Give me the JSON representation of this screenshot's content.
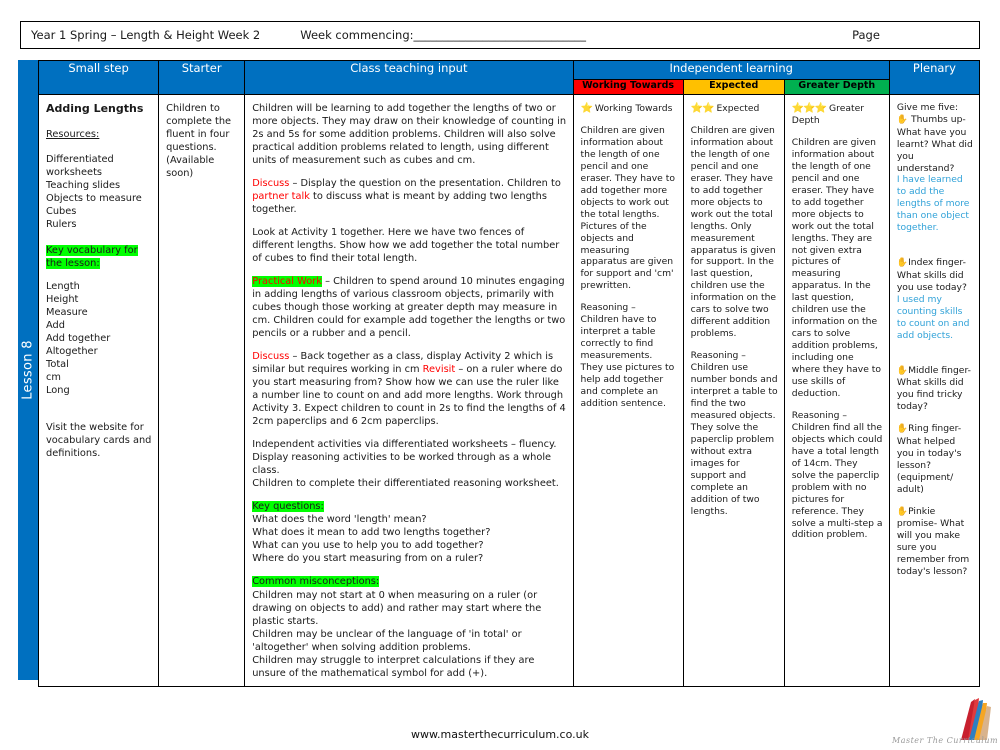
{
  "header": {
    "title": "Year 1 Spring – Length & Height Week 2",
    "week_commencing_label": "Week commencing:",
    "week_commencing_value": "______________________________",
    "page_label": "Page"
  },
  "lesson_tab": {
    "label": "Lesson 8"
  },
  "columns": {
    "small_step": "Small step",
    "starter": "Starter",
    "class_teaching_input": "Class teaching input",
    "independent_learning": "Independent learning",
    "plenary": "Plenary",
    "working_towards": "Working Towards",
    "expected": "Expected",
    "greater_depth": "Greater Depth"
  },
  "colors": {
    "header_blue": "#0070C0",
    "working_towards_red": "#FF0000",
    "expected_amber": "#FFC000",
    "greater_depth_green": "#00B050",
    "highlight_green": "#00FF00",
    "accent_red_text": "#FF0000",
    "plenary_blue_text": "#31A2D8",
    "star_gold": "#FFC000"
  },
  "small_step": {
    "title": "Adding Lengths",
    "resources_label": "Resources:",
    "resources": [
      "Differentiated worksheets",
      "Teaching slides",
      "Objects to measure",
      "Cubes",
      "Rulers"
    ],
    "key_vocabulary_label": "Key vocabulary for the lesson:",
    "vocabulary": [
      "Length",
      "Height",
      "Measure",
      "Add",
      "Add together",
      "Altogether",
      "Total",
      "cm",
      "Long"
    ],
    "website_note": "Visit the website for vocabulary cards and definitions."
  },
  "starter": {
    "text": "Children to complete the fluent in four questions. (Available soon)"
  },
  "teaching_input": {
    "intro": "Children will be learning to add together the lengths of two or more objects. They may draw on their knowledge of counting in 2s and 5s for some addition problems. Children will also solve practical addition problems related to length, using different units of measurement such as cubes and cm.",
    "discuss_label_1": "Discuss",
    "discuss_1_a": " – Display the question on the presentation. Children to ",
    "partner_talk_label": "partner talk",
    "discuss_1_b": " to discuss what is meant by adding two lengths together.",
    "activity_1": "Look at Activity 1 together. Here we have two fences of different lengths. Show how we add together the total number of cubes to find their total length.",
    "practical_label": "Practical Work",
    "practical_text": " – Children to spend around 10 minutes engaging in adding lengths of various classroom objects, primarily with cubes though those working at greater depth may measure in cm. Children could for example add together the lengths or two pencils or a rubber and a pencil.",
    "discuss_label_2": "Discuss",
    "discuss_2_a": " – Back together as a class, display Activity 2 which is similar but requires working in cm ",
    "revisit_label": "Revisit",
    "discuss_2_b": " – on a ruler where do you start measuring from? Show how we can use the ruler like a number line to count on and add more lengths. Work through Activity 3. Expect children to count in 2s to find the lengths of 4 2cm paperclips and 6 2cm paperclips.",
    "independent": [
      "Independent activities via differentiated worksheets – fluency.",
      "Display reasoning activities to be worked through as a whole class.",
      "Children to complete their differentiated reasoning worksheet."
    ],
    "key_questions_label": "Key questions:",
    "key_questions": [
      "What does the word 'length' mean?",
      "What does it mean to add two lengths together?",
      "What can you use to help you to add together?",
      "Where do you start measuring from on a ruler?"
    ],
    "misconceptions_label": "Common misconceptions:",
    "misconceptions": [
      "Children may not start at 0 when measuring on a ruler (or drawing on objects to add) and rather may start where the plastic starts.",
      "Children may be unclear of the language of 'in total' or 'altogether' when solving addition problems.",
      "Children may struggle to interpret calculations if they are unsure of the mathematical symbol for add (+)."
    ]
  },
  "working_towards": {
    "stars": "⭐",
    "heading": "Working Towards",
    "body": "Children are given information about the length of one pencil and one eraser. They have to add together more objects to work out the total lengths. Pictures of the objects and measuring apparatus are given for support and 'cm' prewritten.",
    "reasoning": "Reasoning – Children have to interpret a table correctly to find measurements. They use pictures to help add together and complete an addition sentence."
  },
  "expected": {
    "stars": "⭐⭐",
    "heading": "Expected",
    "body": "Children are given information about the length of one pencil and one eraser. They have to add together more objects to work out the total lengths. Only measurement apparatus is given for support. In the last question, children use the information on the cars to solve two different addition problems.",
    "reasoning": "Reasoning – Children use number bonds and interpret a table to find the two measured objects. They solve the paperclip problem without extra images for support and complete an addition of two lengths."
  },
  "greater_depth": {
    "stars": "⭐⭐⭐",
    "heading": "Greater Depth",
    "body": "Children are given information about the length of one pencil and one eraser. They have to add together more objects to work out the total lengths. They are not given extra pictures of measuring apparatus. In the last question, children use the information on the cars to solve addition problems, including one where they have to use skills of deduction.",
    "reasoning": "Reasoning – Children find all the objects which could have a total length of 14cm. They solve the paperclip problem with no pictures for reference. They solve a multi-step a ddition problem."
  },
  "plenary": {
    "intro": "Give me five:",
    "items": [
      {
        "prompt": "Thumbs up- What have you learnt? What did you understand?",
        "answer": "I have learned to add the lengths of more than one object together."
      },
      {
        "prompt": "Index finger- What skills did you use today?",
        "answer": "I used my counting skills to count on and add objects."
      },
      {
        "prompt": "Middle finger- What skills did you find tricky today?",
        "answer": ""
      },
      {
        "prompt": "Ring finger- What helped you in today's lesson? (equipment/ adult)",
        "answer": ""
      },
      {
        "prompt": "Pinkie promise- What will you make sure you remember from today's lesson?",
        "answer": ""
      }
    ]
  },
  "footer": {
    "url": "www.masterthecurriculum.co.uk",
    "logo_text": "Master  The  Curriculum"
  }
}
